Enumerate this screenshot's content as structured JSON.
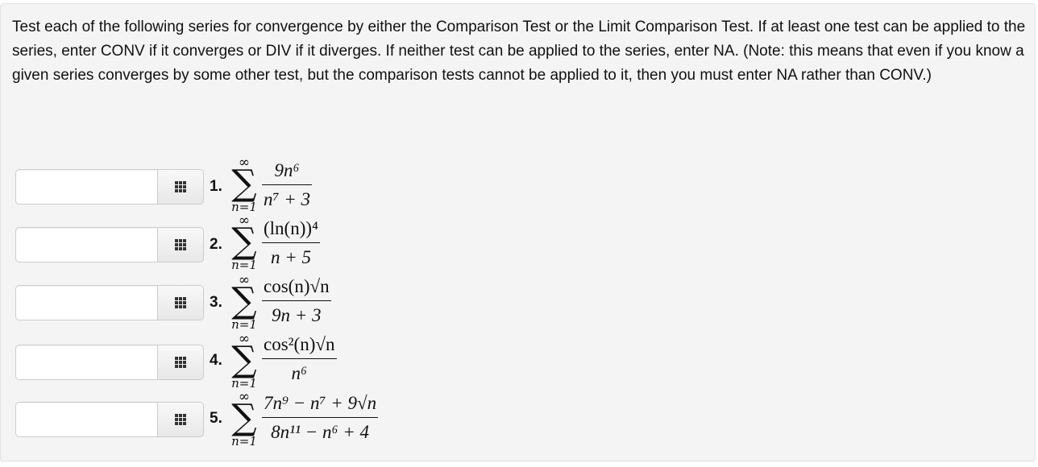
{
  "instructions": "Test each of the following series for convergence by either the Comparison Test or the Limit Comparison Test. If at least one test can be applied to the series, enter CONV if it converges or DIV if it diverges. If neither test can be applied to the series, enter NA. (Note: this means that even if you know a given series converges by some other test, but the comparison tests cannot be applied to it, then you must enter NA rather than CONV.)",
  "keypad_icon": "grid-icon",
  "problems": [
    {
      "label": "1.",
      "answer_value": "",
      "sum_lower": "n=1",
      "sum_upper": "∞",
      "numerator": "9n⁶",
      "denominator": "n⁷ + 3"
    },
    {
      "label": "2.",
      "answer_value": "",
      "sum_lower": "n=1",
      "sum_upper": "∞",
      "numerator": "(ln(n))⁴",
      "denominator": "n + 5"
    },
    {
      "label": "3.",
      "answer_value": "",
      "sum_lower": "n=1",
      "sum_upper": "∞",
      "numerator": "cos(n)√n",
      "denominator": "9n + 3"
    },
    {
      "label": "4.",
      "answer_value": "",
      "sum_lower": "n=1",
      "sum_upper": "∞",
      "numerator": "cos²(n)√n",
      "denominator": "n⁶"
    },
    {
      "label": "5.",
      "answer_value": "",
      "sum_lower": "n=1",
      "sum_upper": "∞",
      "numerator": "7n⁹ − n⁷ + 9√n",
      "denominator": "8n¹¹ − n⁶ + 4"
    }
  ]
}
